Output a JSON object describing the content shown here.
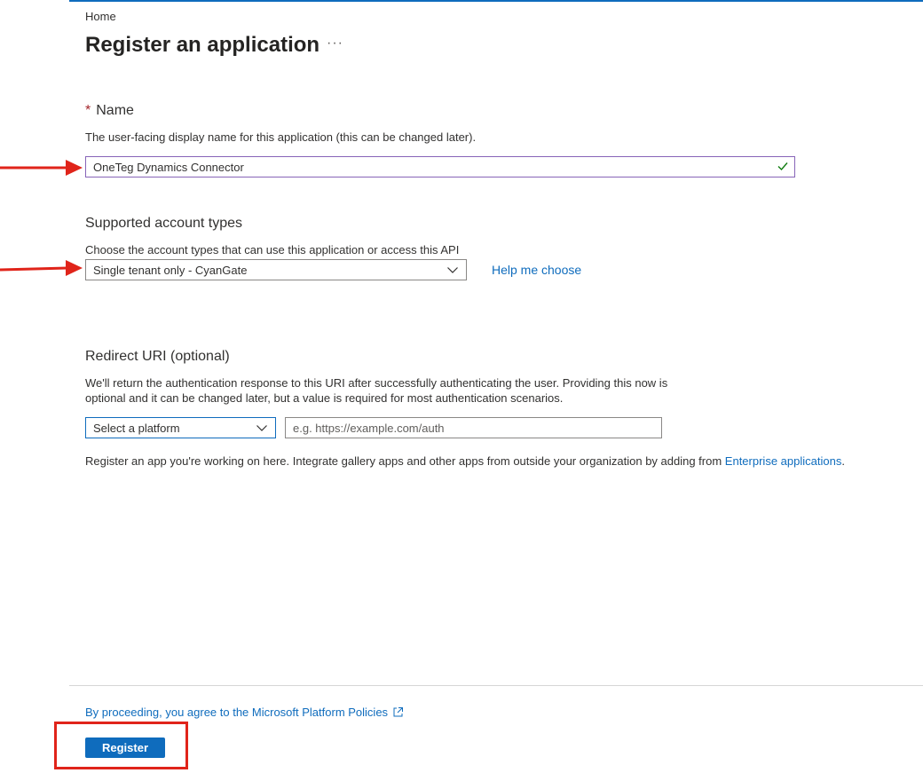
{
  "breadcrumb": "Home",
  "page_title": "Register an application",
  "more_label": "···",
  "name_section": {
    "required_mark": "*",
    "label": "Name",
    "description": "The user-facing display name for this application (this can be changed later).",
    "value": "OneTeg Dynamics Connector"
  },
  "account_section": {
    "label": "Supported account types",
    "description": "Choose the account types that can use this application or access this API",
    "selected": "Single tenant only - CyanGate",
    "help_link": "Help me choose"
  },
  "redirect_section": {
    "label": "Redirect URI (optional)",
    "description_line1": "We'll return the authentication response to this URI after successfully authenticating the user. Providing this now is",
    "description_line2": "optional and it can be changed later, but a value is required for most authentication scenarios.",
    "platform_selected": "Select a platform",
    "uri_placeholder": "e.g. https://example.com/auth"
  },
  "register_note": {
    "text": "Register an app you're working on here. Integrate gallery apps and other apps from outside your organization by adding from ",
    "link": "Enterprise applications",
    "suffix": "."
  },
  "footer": {
    "policy_link": "By proceeding, you agree to the Microsoft Platform Policies",
    "register_label": "Register"
  },
  "colors": {
    "accent": "#0f6cbd",
    "annotation_red": "#e0241a",
    "focus_purple": "#8764b8",
    "check_green": "#107c10"
  }
}
